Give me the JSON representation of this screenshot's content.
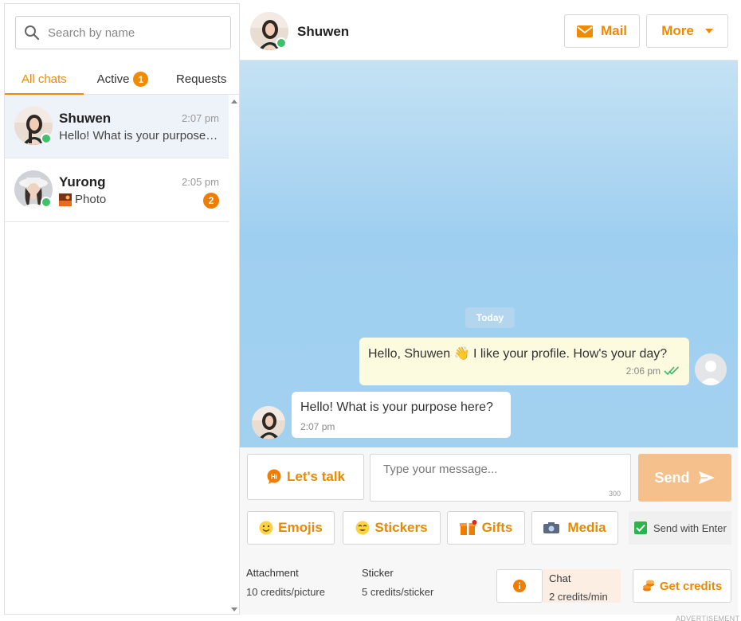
{
  "search": {
    "placeholder": "Search by name",
    "icon": "search-icon"
  },
  "tabs": [
    {
      "label": "All chats",
      "active": true
    },
    {
      "label": "Active",
      "badge": "1"
    },
    {
      "label": "Requests"
    }
  ],
  "chats": [
    {
      "name": "Shuwen",
      "time": "2:07 pm",
      "preview": "Hello! What is your purpose here?",
      "online": true,
      "selected": true
    },
    {
      "name": "Yurong",
      "time": "2:05 pm",
      "preview": "Photo",
      "preview_icon": "photo-thumbnail",
      "unread": "2",
      "online": true
    }
  ],
  "header": {
    "name": "Shuwen",
    "mail_label": "Mail",
    "more_label": "More"
  },
  "conversation": {
    "date_label": "Today",
    "messages": [
      {
        "direction": "out",
        "text": "Hello, Shuwen 👋 I like your profile. How's your day?",
        "time": "2:06 pm",
        "status": "read"
      },
      {
        "direction": "in",
        "text": "Hello! What is your purpose here?",
        "time": "2:07 pm"
      }
    ]
  },
  "composer": {
    "lets_talk_label": "Let's talk",
    "placeholder": "Type your message...",
    "char_limit": "300",
    "send_label": "Send",
    "emojis_label": "Emojis",
    "stickers_label": "Stickers",
    "gifts_label": "Gifts",
    "media_label": "Media",
    "send_with_enter_label": "Send with Enter",
    "send_with_enter_checked": true
  },
  "costs": {
    "attachment_label": "Attachment",
    "attachment_cost": "10 credits/picture",
    "sticker_label": "Sticker",
    "sticker_cost": "5 credits/sticker",
    "chat_label": "Chat",
    "chat_cost": "2 credits/min",
    "get_credits_label": "Get credits"
  },
  "ad_label": "ADVERTISEMENT",
  "colors": {
    "accent": "#f08a00",
    "online": "#3fc06a",
    "send_disabled": "#f5c08c"
  }
}
